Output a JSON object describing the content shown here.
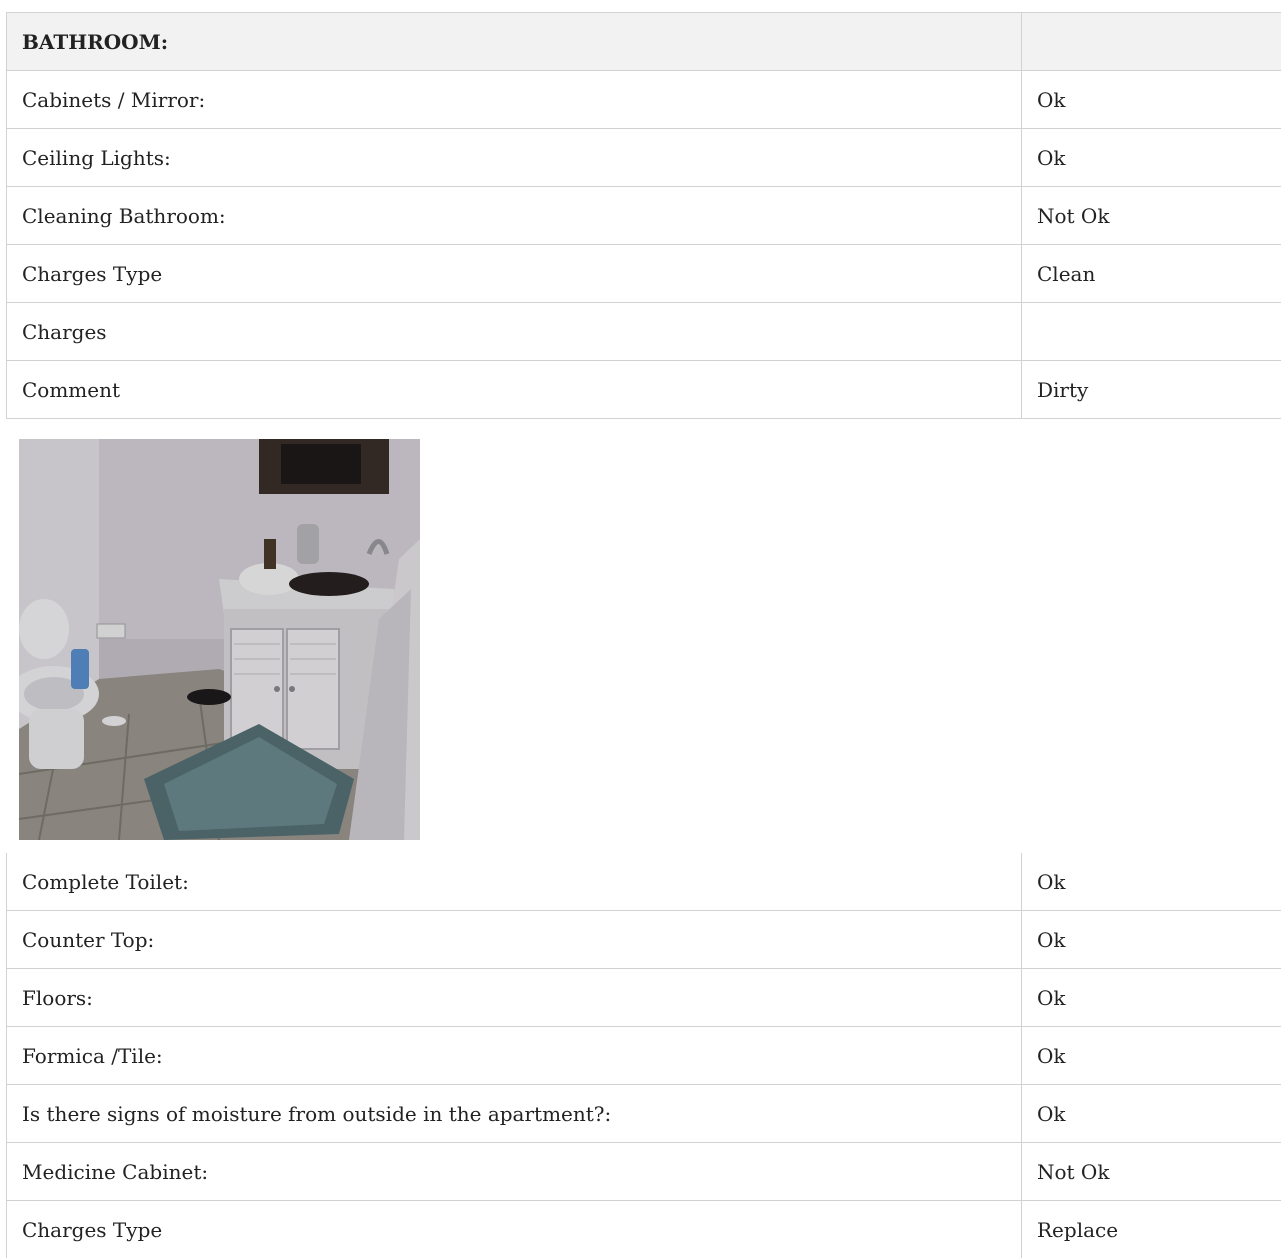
{
  "section": {
    "title": "BATHROOM:",
    "header_value": ""
  },
  "rows_top": [
    {
      "label": "Cabinets / Mirror:",
      "value": "Ok"
    },
    {
      "label": "Ceiling Lights:",
      "value": "Ok"
    },
    {
      "label": "Cleaning Bathroom:",
      "value": "Not Ok"
    },
    {
      "label": "Charges Type",
      "value": "Clean"
    },
    {
      "label": "Charges",
      "value": ""
    },
    {
      "label": "Comment",
      "value": "Dirty"
    }
  ],
  "rows_bottom": [
    {
      "label": "Complete Toilet:",
      "value": "Ok"
    },
    {
      "label": "Counter Top:",
      "value": "Ok"
    },
    {
      "label": "Floors:",
      "value": "Ok"
    },
    {
      "label": "Formica /Tile:",
      "value": "Ok"
    },
    {
      "label": "Is there signs of moisture from outside in the apartment?:",
      "value": "Ok"
    },
    {
      "label": "Medicine Cabinet:",
      "value": "Not Ok"
    },
    {
      "label": "Charges Type",
      "value": "Replace"
    }
  ],
  "colors": {
    "header_bg": "#f2f2f2",
    "border": "#d2d2d2",
    "text": "#222222"
  }
}
